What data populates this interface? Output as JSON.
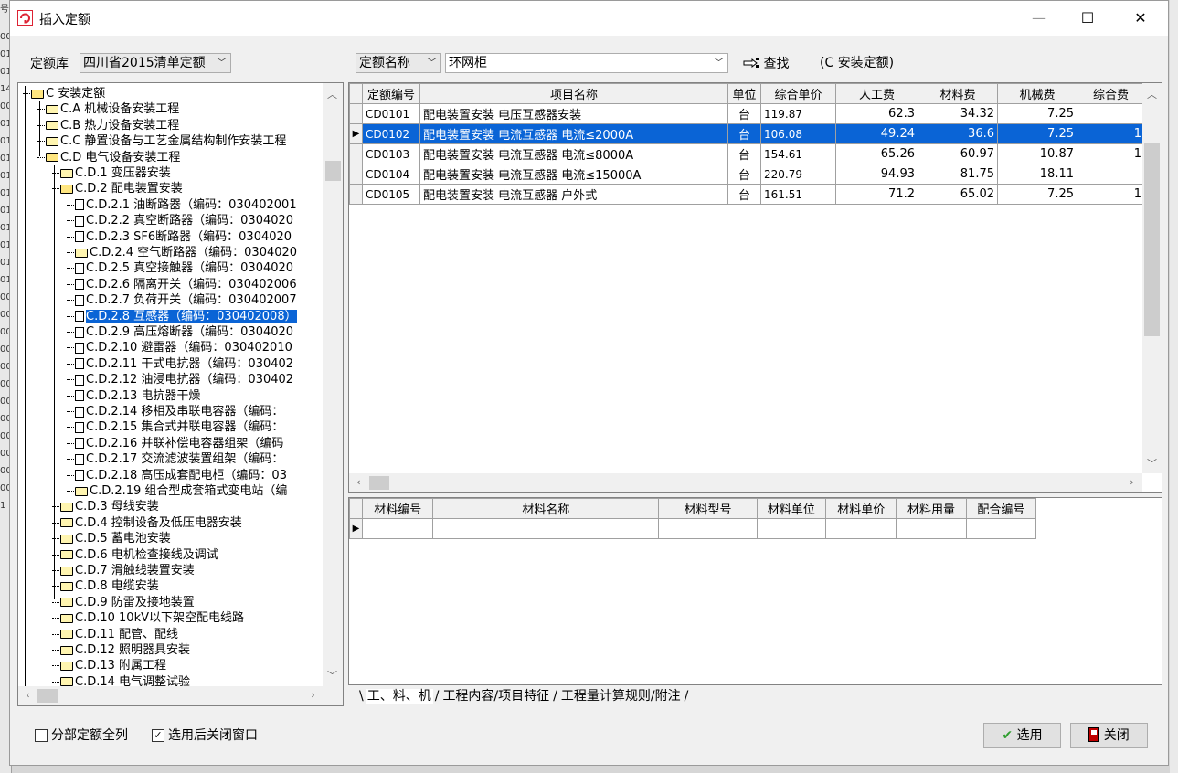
{
  "background_left_strip": [
    "号",
    "00",
    "01",
    "01",
    "14",
    "00",
    "01",
    "01",
    "01",
    "01",
    "01",
    "01",
    "01",
    "01",
    "01",
    "01",
    "00",
    "00",
    "00",
    "00",
    "00",
    "00",
    "00",
    "00",
    "00",
    "00",
    "00",
    "00",
    "1"
  ],
  "window": {
    "title": "插入定额",
    "minimize": "—",
    "maximize": "☐",
    "close": "✕"
  },
  "toolbar": {
    "library_label": "定额库",
    "library_value": "四川省2015清单定额",
    "search_field": "定额名称",
    "search_value": "环网柜",
    "find_button": "查找",
    "scope_label": "(C 安装定额)"
  },
  "tree": {
    "nodes": [
      {
        "text": "C 安装定额",
        "level": 0,
        "icon": "folder-open"
      },
      {
        "text": "C.A 机械设备安装工程",
        "level": 1,
        "icon": "folder"
      },
      {
        "text": "C.B 热力设备安装工程",
        "level": 1,
        "icon": "folder"
      },
      {
        "text": "C.C 静置设备与工艺金属结构制作安装工程",
        "level": 1,
        "icon": "folder"
      },
      {
        "text": "C.D 电气设备安装工程",
        "level": 1,
        "icon": "folder-open"
      },
      {
        "text": "C.D.1 变压器安装",
        "level": 2,
        "icon": "folder"
      },
      {
        "text": "C.D.2 配电装置安装",
        "level": 2,
        "icon": "folder-open"
      },
      {
        "text": "C.D.2.1 油断路器（编码：030402001",
        "level": 3,
        "icon": "doc"
      },
      {
        "text": "C.D.2.2 真空断路器（编码：0304020",
        "level": 3,
        "icon": "doc"
      },
      {
        "text": "C.D.2.3 SF6断路器（编码：0304020",
        "level": 3,
        "icon": "doc"
      },
      {
        "text": "C.D.2.4 空气断路器（编码：0304020",
        "level": 3,
        "icon": "folder"
      },
      {
        "text": "C.D.2.5 真空接触器（编码：0304020",
        "level": 3,
        "icon": "doc"
      },
      {
        "text": "C.D.2.6 隔离开关（编码：030402006",
        "level": 3,
        "icon": "doc"
      },
      {
        "text": "C.D.2.7 负荷开关（编码：030402007",
        "level": 3,
        "icon": "doc"
      },
      {
        "text": "C.D.2.8 互感器（编码：030402008）",
        "level": 3,
        "icon": "doc",
        "selected": true
      },
      {
        "text": "C.D.2.9 高压熔断器（编码：0304020",
        "level": 3,
        "icon": "doc"
      },
      {
        "text": "C.D.2.10 避雷器（编码：030402010",
        "level": 3,
        "icon": "doc"
      },
      {
        "text": "C.D.2.11 干式电抗器（编码：030402",
        "level": 3,
        "icon": "doc"
      },
      {
        "text": "C.D.2.12 油浸电抗器（编码：030402",
        "level": 3,
        "icon": "doc"
      },
      {
        "text": "C.D.2.13 电抗器干燥",
        "level": 3,
        "icon": "doc"
      },
      {
        "text": "C.D.2.14 移相及串联电容器（编码：",
        "level": 3,
        "icon": "doc"
      },
      {
        "text": "C.D.2.15 集合式并联电容器（编码：",
        "level": 3,
        "icon": "doc"
      },
      {
        "text": "C.D.2.16 并联补偿电容器组架（编码",
        "level": 3,
        "icon": "doc"
      },
      {
        "text": "C.D.2.17 交流滤波装置组架（编码：",
        "level": 3,
        "icon": "doc"
      },
      {
        "text": "C.D.2.18 高压成套配电柜（编码：03",
        "level": 3,
        "icon": "doc"
      },
      {
        "text": "C.D.2.19 组合型成套箱式变电站（编",
        "level": 3,
        "icon": "folder"
      },
      {
        "text": "C.D.3 母线安装",
        "level": 2,
        "icon": "folder"
      },
      {
        "text": "C.D.4 控制设备及低压电器安装",
        "level": 2,
        "icon": "folder"
      },
      {
        "text": "C.D.5 蓄电池安装",
        "level": 2,
        "icon": "folder"
      },
      {
        "text": "C.D.6 电机检查接线及调试",
        "level": 2,
        "icon": "folder"
      },
      {
        "text": "C.D.7 滑触线装置安装",
        "level": 2,
        "icon": "folder"
      },
      {
        "text": "C.D.8 电缆安装",
        "level": 2,
        "icon": "folder"
      },
      {
        "text": "C.D.9 防雷及接地装置",
        "level": 2,
        "icon": "folder"
      },
      {
        "text": "C.D.10 10kV以下架空配电线路",
        "level": 2,
        "icon": "folder"
      },
      {
        "text": "C.D.11 配管、配线",
        "level": 2,
        "icon": "folder"
      },
      {
        "text": "C.D.12 照明器具安装",
        "level": 2,
        "icon": "folder"
      },
      {
        "text": "C.D.13 附属工程",
        "level": 2,
        "icon": "folder"
      },
      {
        "text": "C.D.14 电气调整试验",
        "level": 2,
        "icon": "folder"
      }
    ]
  },
  "quota_grid": {
    "columns": [
      "定额编号",
      "项目名称",
      "单位",
      "综合单价",
      "人工费",
      "材料费",
      "机械费",
      "综合费"
    ],
    "rows": [
      {
        "code": "CD0101",
        "name": "配电装置安装 电压互感器安装",
        "unit": "台",
        "price": "119.87",
        "labor": "62.3",
        "material": "34.32",
        "machine": "7.25",
        "overall": ""
      },
      {
        "code": "CD0102",
        "name": "配电装置安装 电流互感器 电流≤2000A",
        "unit": "台",
        "price": "106.08",
        "labor": "49.24",
        "material": "36.6",
        "machine": "7.25",
        "overall": "1",
        "selected": true
      },
      {
        "code": "CD0103",
        "name": "配电装置安装 电流互感器 电流≤8000A",
        "unit": "台",
        "price": "154.61",
        "labor": "65.26",
        "material": "60.97",
        "machine": "10.87",
        "overall": "1"
      },
      {
        "code": "CD0104",
        "name": "配电装置安装 电流互感器 电流≤15000A",
        "unit": "台",
        "price": "220.79",
        "labor": "94.93",
        "material": "81.75",
        "machine": "18.11",
        "overall": ""
      },
      {
        "code": "CD0105",
        "name": "配电装置安装 电流互感器 户外式",
        "unit": "台",
        "price": "161.51",
        "labor": "71.2",
        "material": "65.02",
        "machine": "7.25",
        "overall": "1"
      }
    ]
  },
  "material_grid": {
    "columns": [
      "材料编号",
      "材料名称",
      "材料型号",
      "材料单位",
      "材料单价",
      "材料用量",
      "配合编号"
    ]
  },
  "bottom_tabs": [
    "工、料、机",
    "工程内容/项目特征",
    "工程量计算规则/附注"
  ],
  "options": {
    "list_all_label": "分部定额全列",
    "list_all_checked": false,
    "close_after_label": "选用后关闭窗口",
    "close_after_checked": true
  },
  "buttons": {
    "select": "选用",
    "close": "关闭"
  },
  "colors": {
    "selection": "#0a64d6",
    "select_icon": "#2e9e2e",
    "close_icon": "#c00000"
  }
}
